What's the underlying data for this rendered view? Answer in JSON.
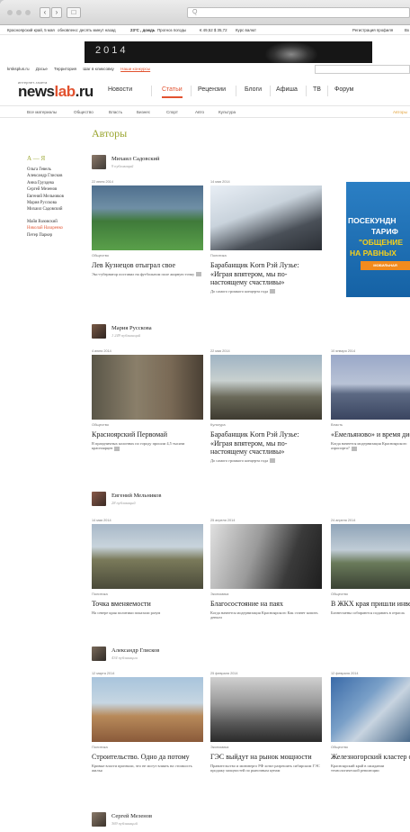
{
  "browser": {
    "url_placeholder": "Q"
  },
  "infobar": {
    "region": "Красноярский край, 5 мая",
    "updated": "обновлено: десять минут назад",
    "weather": "23°С , дождь",
    "weather_link": "Прогноз погоды",
    "currency": "€ 49,52  $ 35,72",
    "currency_link": "Курс валют",
    "auth": "Регистрация профиля",
    "login": "Вх"
  },
  "banner": {
    "text": "2014"
  },
  "toplinks": [
    "krsksplus.ru",
    "Досье",
    "Территория",
    "Шаг в кликсовку",
    "Наши конкурсы"
  ],
  "logo": {
    "small": "интернет-газета",
    "big_a": "news",
    "big_b": "lab",
    "big_c": ".ru"
  },
  "mainnav": [
    "Новости",
    "Статьи",
    "Рецензии",
    "Блоги",
    "Афиша",
    "ТВ",
    "Форум"
  ],
  "subnav": [
    "Все материалы",
    "Общество",
    "Власть",
    "Бизнес",
    "Спорт",
    "Авто",
    "Культура",
    "Авторы"
  ],
  "page_title": "Авторы",
  "sidebar": {
    "head": "А — Я",
    "items": [
      "Ольга Гевель",
      "Александр Глисков",
      "Анна Груздева",
      "Сергей Мезенов",
      "Евгений Мельников",
      "Мария Русскова",
      "Михаил Садовский"
    ],
    "items2": [
      "Майя Вазовский",
      "Николай Назаренко",
      "Петер Паркер"
    ]
  },
  "authors": [
    {
      "name": "Михаил Садовский",
      "count": "9 публикаций",
      "cards": [
        {
          "date": "22 июня 2014",
          "cat": "Общество",
          "title": "Лев Кузнецов отыграл свое",
          "desc": "Экс-губернатор поставил на футбольном поле жирную точку"
        },
        {
          "date": "14 мая 2014",
          "cat": "Политика",
          "title": "Барабанщик Korn Рэй Лузье: «Играя впятером, мы по-настоящему счастливы»",
          "desc": "До самого громкого концерта года"
        }
      ]
    },
    {
      "name": "Мария Русскова",
      "count": "1 249 публикаций",
      "cards": [
        {
          "date": "4 июня 2014",
          "cat": "Общество",
          "title": "Красноярский Первомай",
          "desc": "В праздничных колоннах по городу прошли 4,5 тысячи красноярцев"
        },
        {
          "date": "22 мая 2014",
          "cat": "Культура",
          "title": "Барабанщик Korn Рэй Лузье: «Играя впятером, мы по-настоящему счастливы»",
          "desc": "До самого громкого концерта года"
        },
        {
          "date": "10 января 2014",
          "cat": "Власть",
          "title": "«Емельяново» и время дискуссий",
          "desc": "Когда начнется модернизация Красноярского аэропорта?"
        }
      ]
    },
    {
      "name": "Евгений Мельников",
      "count": "28 публикаций",
      "cards": [
        {
          "date": "14 мая 2014",
          "cat": "Политика",
          "title": "Точка вменяемости",
          "desc": "На севере края политики показали разум"
        },
        {
          "date": "25 апреля 2014",
          "cat": "Экономика",
          "title": "Благосостояние на паях",
          "desc": "Когда начнется модернизация Красноярского Как станет копить деньги"
        },
        {
          "date": "24 апреля 2014",
          "cat": "Общество",
          "title": "В ЖКХ края пришли инвесторы",
          "desc": "Бизнесмены собираются подавать в отрасль"
        }
      ]
    },
    {
      "name": "Александр Глисков",
      "count": "434 публикации",
      "cards": [
        {
          "date": "12 марта 2014",
          "cat": "Политика",
          "title": "Строительство. Одно да потому",
          "desc": "Кривые власти признали, что не могут влиять на стоимость жилья"
        },
        {
          "date": "25 февраля 2014",
          "cat": "Экономика",
          "title": "ГЭС выйдут на рынок мощности",
          "desc": "Правительство и минэнерго РФ хотят разрешить сибирским ГЭС продажу мощностей по рыночным ценам"
        },
        {
          "date": "12 февраля 2014",
          "cat": "Общество",
          "title": "Железногорский кластер обретает конкретные черты",
          "desc": "Красноярский край в ожидании технологической революции"
        }
      ]
    },
    {
      "name": "Сергей Мезенов",
      "count": "369 публикаций",
      "cards": []
    }
  ],
  "ad": {
    "line1": "ПОСЕКУНДН",
    "line2": "ТАРИФ",
    "line3": "\"ОБЩЕНИЕ",
    "line4": "НА РАВНЫХ",
    "bar": "МОБИЛЬНАЯ"
  },
  "colors": {
    "accent": "#e2522f",
    "olive": "#9aa52f"
  }
}
